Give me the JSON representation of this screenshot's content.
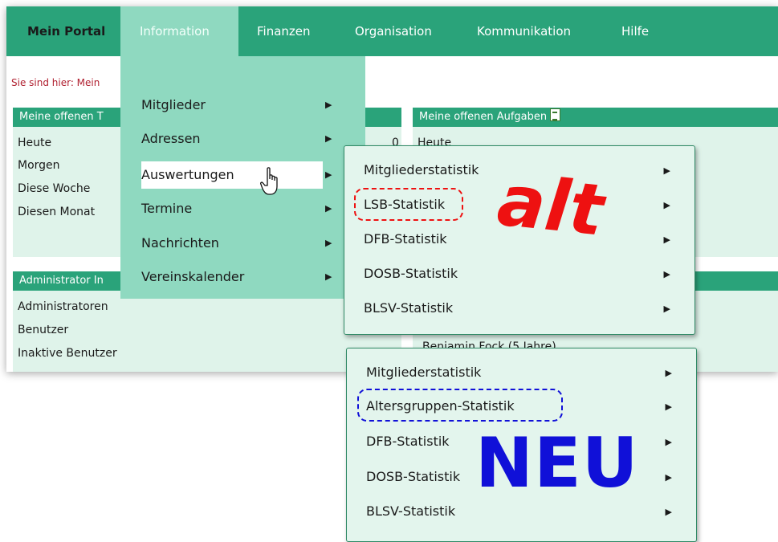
{
  "nav": {
    "items": [
      "Mein Portal",
      "Information",
      "Finanzen",
      "Organisation",
      "Kommunikation",
      "Hilfe"
    ]
  },
  "breadcrumb": "Sie sind hier: Mein",
  "box1": {
    "title": "Meine offenen T",
    "rows": [
      "Heute",
      "Morgen",
      "Diese Woche",
      "Diesen Monat"
    ],
    "count": "0"
  },
  "box2": {
    "title": "Meine offenen Aufgaben",
    "rows": [
      "Heute"
    ]
  },
  "box3": {
    "title": "Administrator In",
    "rows": [
      "Administratoren",
      "Benutzer",
      "Inaktive Benutzer"
    ]
  },
  "box4": {
    "partial_row": "Benjamin Fock (5 Jahre)"
  },
  "menu": {
    "items": [
      "Mitglieder",
      "Adressen",
      "Auswertungen",
      "Termine",
      "Nachrichten",
      "Vereinskalender"
    ],
    "highlighted": "Auswertungen"
  },
  "submenu_old": {
    "items": [
      "Mitgliederstatistik",
      "LSB-Statistik",
      "DFB-Statistik",
      "DOSB-Statistik",
      "BLSV-Statistik"
    ],
    "circled": "LSB-Statistik",
    "label": "alt"
  },
  "submenu_new": {
    "items": [
      "Mitgliederstatistik",
      "Altersgruppen-Statistik",
      "DFB-Statistik",
      "DOSB-Statistik",
      "BLSV-Statistik"
    ],
    "circled": "Altersgruppen-Statistik",
    "label": "NEU"
  },
  "colors": {
    "nav": "#2aa37a",
    "menu": "#8fd9c0",
    "box": "#dff3ea",
    "old_mark": "#ee1111",
    "new_mark": "#1010d8"
  },
  "icons": [
    "chevron-right-icon",
    "hand-pointer-icon",
    "document-icon"
  ]
}
